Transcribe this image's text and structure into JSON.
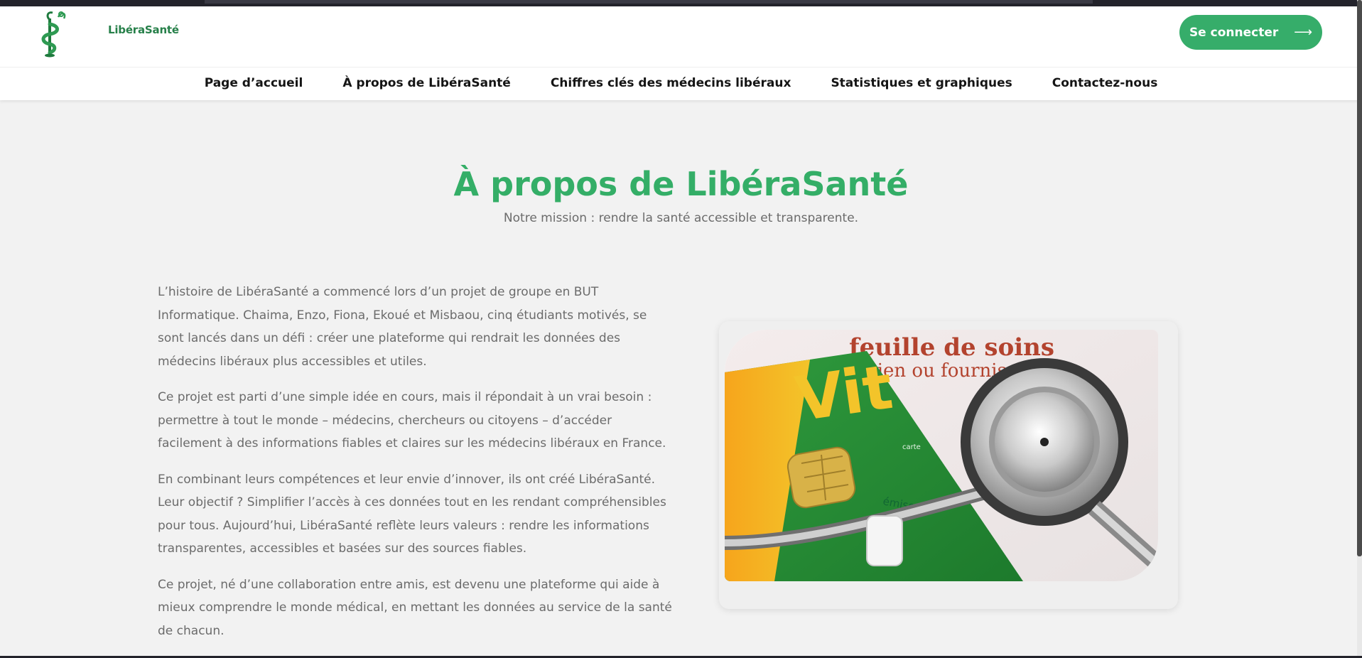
{
  "brand": {
    "name": "LibéraSanté",
    "accent": "#36ad6a",
    "title_color": "#34ae67"
  },
  "header": {
    "login_label": "Se connecter",
    "login_arrow": "⟶"
  },
  "nav": {
    "items": [
      {
        "label": "Page d’accueil"
      },
      {
        "label": "À propos de LibéraSanté"
      },
      {
        "label": "Chiffres clés des médecins libéraux"
      },
      {
        "label": "Statistiques et graphiques"
      },
      {
        "label": "Contactez-nous"
      }
    ]
  },
  "main": {
    "title": "À propos de LibéraSanté",
    "subtitle": "Notre mission : rendre la santé accessible et transparente.",
    "paragraphs": [
      "L’histoire de LibéraSanté a commencé lors d’un projet de groupe en BUT Informatique. Chaima, Enzo, Fiona, Ekoué et Misbaou, cinq étudiants motivés, se sont lancés dans un défi : créer une plateforme qui rendrait les données des médecins libéraux plus accessibles et utiles.",
      "Ce projet est parti d’une simple idée en cours, mais il répondait à un vrai besoin : permettre à tout le monde – médecins, chercheurs ou citoyens – d’accéder facilement à des informations fiables et claires sur les médecins libéraux en France.",
      "En combinant leurs compétences et leur envie d’innover, ils ont créé LibéraSanté. Leur objectif ? Simplifier l’accès à ces données tout en les rendant compréhensibles pour tous. Aujourd’hui, LibéraSanté reflète leurs valeurs : rendre les informations transparentes, accessibles et basées sur des sources fiables.",
      "Ce projet, né d’une collaboration entre amis, est devenu une plateforme qui aide à mieux comprendre le monde médical, en mettant les données au service de la santé de chacun."
    ],
    "image": {
      "icon": "vitale-card-stethoscope-photo",
      "texts": {
        "form_title": "feuille de soins",
        "form_line": "macien ou fournisseur",
        "card_brand": "Vit",
        "card_small": "carte",
        "card_emise": "émise"
      }
    }
  }
}
